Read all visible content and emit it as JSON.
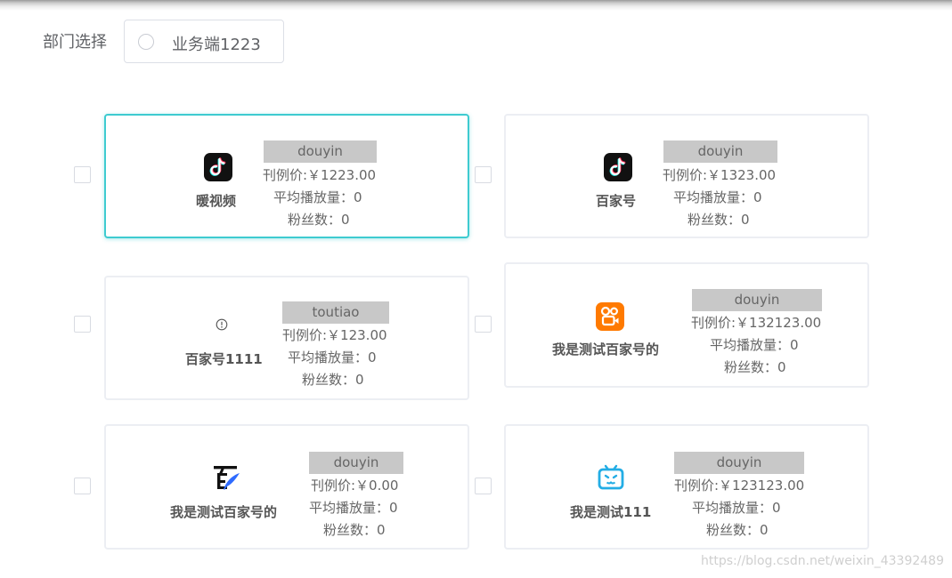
{
  "filter": {
    "label": "部门选择",
    "department_option": "业务端1223"
  },
  "accounts": [
    {
      "name": "暖视频",
      "icon": "douyin-icon",
      "platform": "douyin",
      "price": "刊例价:￥1223.00",
      "avg_plays": "平均播放量：0",
      "fans": "粉丝数：0",
      "selected": true
    },
    {
      "name": "百家号",
      "icon": "douyin-icon",
      "platform": "douyin",
      "price": "刊例价:￥1323.00",
      "avg_plays": "平均播放量：0",
      "fans": "粉丝数：0",
      "selected": false
    },
    {
      "name": "百家号1111",
      "icon": "info-circle-icon",
      "platform": "toutiao",
      "price": "刊例价:￥123.00",
      "avg_plays": "平均播放量：0",
      "fans": "粉丝数：0",
      "selected": false
    },
    {
      "name": "我是测试百家号的",
      "icon": "kuaishou-icon",
      "platform": "douyin",
      "price": "刊例价:￥132123.00",
      "avg_plays": "平均播放量：0",
      "fans": "粉丝数：0",
      "selected": false
    },
    {
      "name": "我是测试百家号的",
      "icon": "baijiahao-icon",
      "platform": "douyin",
      "price": "刊例价:￥0.00",
      "avg_plays": "平均播放量：0",
      "fans": "粉丝数：0",
      "selected": false
    },
    {
      "name": "我是测试111",
      "icon": "bilibili-icon",
      "platform": "douyin",
      "price": "刊例价:￥123123.00",
      "avg_plays": "平均播放量：0",
      "fans": "粉丝数：0",
      "selected": false
    }
  ],
  "watermark": "https://blog.csdn.net/weixin_43392489",
  "colors": {
    "selected_border": "#3ecbd0",
    "tag_background": "#c8c8c8",
    "kuaishou_orange": "#ff7a00",
    "bilibili_blue": "#23ade5"
  }
}
